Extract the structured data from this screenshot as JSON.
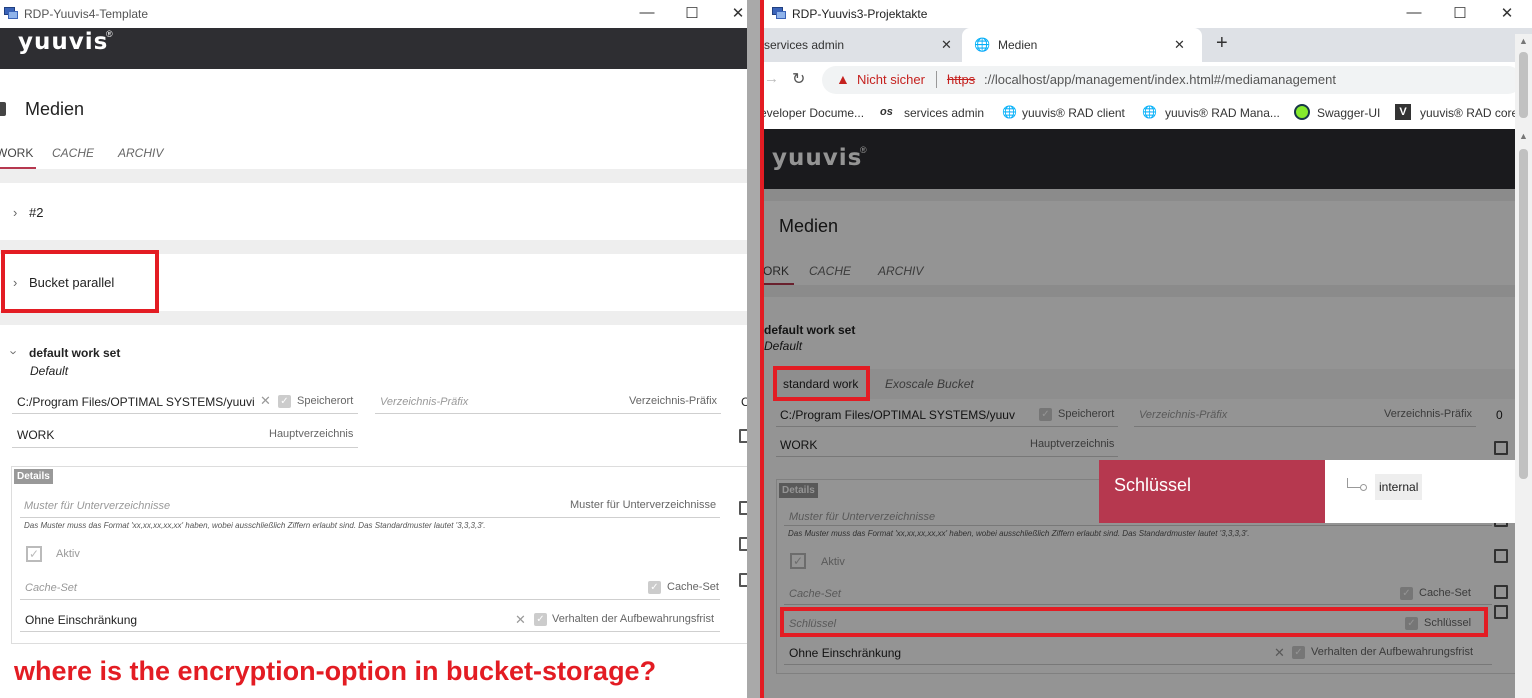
{
  "left": {
    "title": "RDP-Yuuvis4-Template",
    "logo": "yuuvis",
    "logo_mark": "®",
    "page_title": "Medien",
    "tabs": [
      "WORK",
      "CACHE",
      "ARCHIV"
    ],
    "sections": {
      "s2": "#2",
      "bucket": "Bucket parallel",
      "default": "default work set",
      "default_sub": "Default"
    },
    "fields": {
      "storage_val": "C:/Program Files/OPTIMAL SYSTEMS/yuuvis",
      "storage_lbl": "Speicherort",
      "prefix_ph": "Verzeichnis-Präfix",
      "prefix_lbl": "Verzeichnis-Präfix",
      "main_val": "WORK",
      "main_lbl": "Hauptverzeichnis",
      "details": "Details",
      "pattern_ph": "Muster für Unterverzeichnisse",
      "pattern_lbl": "Muster für Unterverzeichnisse",
      "hint": "Das Muster muss das Format 'xx,xx,xx,xx,xx' haben, wobei ausschließlich Ziffern erlaubt sind. Das Standardmuster lautet '3,3,3,3'.",
      "active": "Aktiv",
      "cache_ph": "Cache-Set",
      "cache_lbl": "Cache-Set",
      "retention_val": "Ohne Einschränkung",
      "retention_lbl": "Verhalten der Aufbewahrungsfrist",
      "edge_char": "C"
    },
    "question": "where is the encryption-option in bucket-storage?"
  },
  "right": {
    "title": "RDP-Yuuvis3-Projektakte",
    "browser_tabs": [
      {
        "label": "services admin"
      },
      {
        "label": "Medien"
      }
    ],
    "new_tab": "+",
    "security": "Nicht sicher",
    "url_scheme": "https",
    "url_rest": "://localhost/app/management/index.html#/mediamanagement",
    "bookmarks": [
      {
        "label": "eveloper Docume..."
      },
      {
        "label": "services admin",
        "icon": "os"
      },
      {
        "label": "yuuvis® RAD client"
      },
      {
        "label": "yuuvis® RAD Mana..."
      },
      {
        "label": "Swagger-UI"
      },
      {
        "label": "yuuvis® RAD core"
      }
    ],
    "logo": "yuuvis",
    "logo_mark": "®",
    "page_title": "Medien",
    "tabs": [
      "ORK",
      "CACHE",
      "ARCHIV"
    ],
    "default": "default work set",
    "default_sub": "Default",
    "subtabs": [
      "standard work",
      "Exoscale Bucket"
    ],
    "fields": {
      "storage_val": "C:/Program Files/OPTIMAL SYSTEMS/yuuvi",
      "storage_lbl": "Speicherort",
      "prefix_ph": "Verzeichnis-Präfix",
      "prefix_lbl": "Verzeichnis-Präfix",
      "prefix_num": "0",
      "main_val": "WORK",
      "main_lbl": "Hauptverzeichnis",
      "details": "Details",
      "pattern_ph": "Muster für Unterverzeichnisse",
      "hint": "Das Muster muss das Format 'xx,xx,xx,xx,xx' haben, wobei ausschließlich Ziffern erlaubt sind. Das Standardmuster lautet '3,3,3,3'.",
      "active": "Aktiv",
      "cache_ph": "Cache-Set",
      "cache_lbl": "Cache-Set",
      "key_ph": "Schlüssel",
      "key_lbl": "Schlüssel",
      "retention_val": "Ohne Einschränkung",
      "retention_lbl": "Verhalten der Aufbewahrungsfrist"
    },
    "popup": {
      "title": "Schlüssel",
      "option": "internal"
    }
  },
  "colors": {
    "annotation": "#e31c23",
    "accent": "#b6384f",
    "header_dark": "#2e2e32"
  }
}
